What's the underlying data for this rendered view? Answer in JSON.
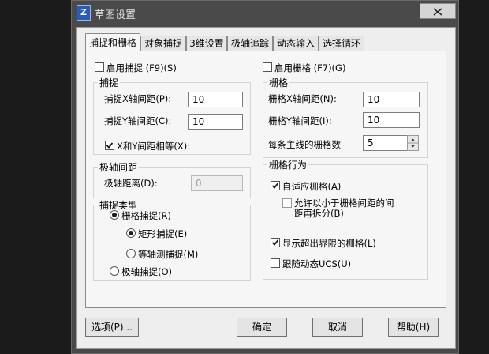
{
  "window": {
    "title": "草图设置"
  },
  "tabs": [
    {
      "label": "捕捉和栅格",
      "active": true
    },
    {
      "label": "对象捕捉"
    },
    {
      "label": "3维设置"
    },
    {
      "label": "极轴追踪"
    },
    {
      "label": "动态输入"
    },
    {
      "label": "选择循环"
    }
  ],
  "snap": {
    "enable_label": "启用捕捉 (F9)(S)",
    "enable_checked": false,
    "group_label": "捕捉",
    "x_label": "捕捉X轴间距(P):",
    "x_value": "10",
    "y_label": "捕捉Y轴间距(C):",
    "y_value": "10",
    "equal_label": "X和Y间距相等(X):",
    "equal_checked": true
  },
  "polar": {
    "group_label": "极轴间距",
    "distance_label": "极轴距离(D):",
    "distance_value": "0"
  },
  "snap_type": {
    "group_label": "捕捉类型",
    "grid_snap_label": "栅格捕捉(R)",
    "rect_snap_label": "矩形捕捉(E)",
    "iso_snap_label": "等轴测捕捉(M)",
    "polar_snap_label": "极轴捕捉(O)",
    "selected": "rect_snap"
  },
  "grid": {
    "enable_label": "启用栅格 (F7)(G)",
    "enable_checked": false,
    "group_label": "栅格",
    "x_label": "栅格X轴间距(N):",
    "x_value": "10",
    "y_label": "栅格Y轴间距(I):",
    "y_value": "10",
    "major_label": "每条主线的栅格数",
    "major_value": "5"
  },
  "grid_behavior": {
    "group_label": "栅格行为",
    "adaptive_label": "自适应栅格(A)",
    "adaptive_checked": true,
    "subdivide_label_line1": "允许以小于栅格间距的间",
    "subdivide_label_line2": "距再拆分(B)",
    "subdivide_checked": false,
    "beyond_limits_label": "显示超出界限的栅格(L)",
    "beyond_limits_checked": true,
    "follow_ucs_label": "跟随动态UCS(U)",
    "follow_ucs_checked": false
  },
  "buttons": {
    "options": "选项(P)...",
    "ok": "确定",
    "cancel": "取消",
    "help": "帮助(H)"
  }
}
